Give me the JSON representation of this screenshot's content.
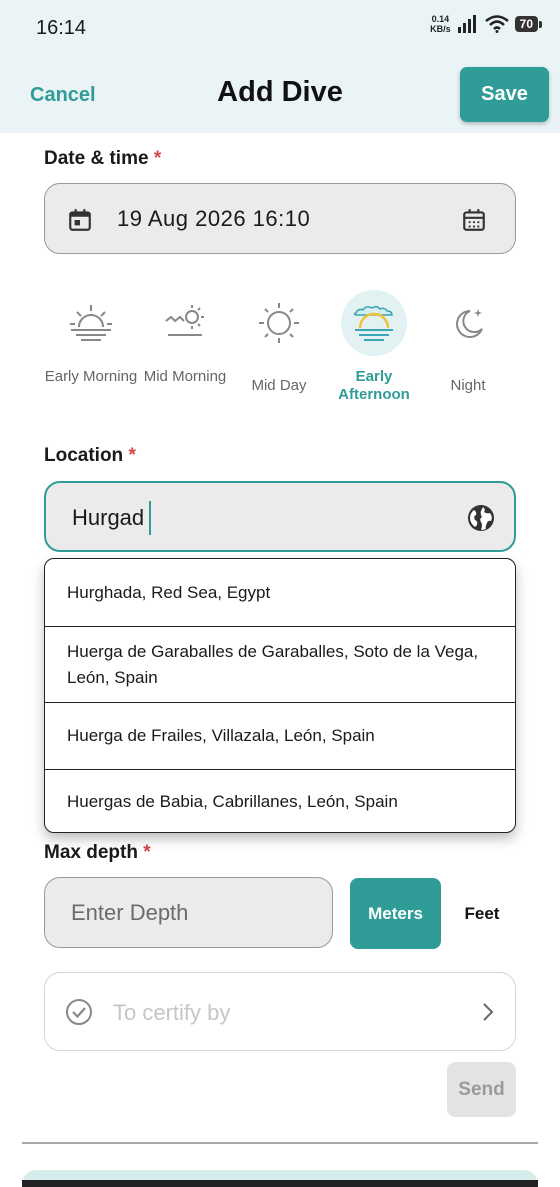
{
  "status_bar": {
    "time": "16:14",
    "net_speed_value": "0.14",
    "net_speed_unit": "KB/s",
    "battery": "70"
  },
  "header": {
    "cancel_label": "Cancel",
    "title": "Add Dive",
    "save_label": "Save"
  },
  "date_time": {
    "label": "Date & time",
    "required_mark": "*",
    "value": "19 Aug 2026 16:10"
  },
  "time_of_day": {
    "options": [
      {
        "label": "Early Morning",
        "icon": "sunrise-icon"
      },
      {
        "label": "Mid Morning",
        "icon": "sun-cloud-horizon-icon"
      },
      {
        "label": "Mid Day",
        "icon": "sun-icon"
      },
      {
        "label": "Early Afternoon",
        "icon": "sunset-clouds-icon",
        "selected": true
      },
      {
        "label": "Night",
        "icon": "moon-star-icon"
      }
    ]
  },
  "location": {
    "label": "Location",
    "required_mark": "*",
    "value": "Hurgad",
    "suggestions": [
      "Hurghada, Red Sea, Egypt",
      "Huerga de Garaballes de Garaballes, Soto de la Vega, León, Spain",
      "Huerga de Frailes, Villazala, León, Spain",
      "Huergas de Babia, Cabrillanes, León, Spain"
    ]
  },
  "max_depth": {
    "label": "Max depth",
    "required_mark": "*",
    "placeholder": "Enter Depth",
    "unit_meters": "Meters",
    "unit_feet": "Feet",
    "selected_unit": "Meters"
  },
  "certify": {
    "placeholder": "To certify by"
  },
  "send_label": "Send",
  "colors": {
    "accent": "#2f9c98",
    "required": "#d64545",
    "header_bg": "#eaf4f6",
    "field_bg": "#ebebeb"
  }
}
